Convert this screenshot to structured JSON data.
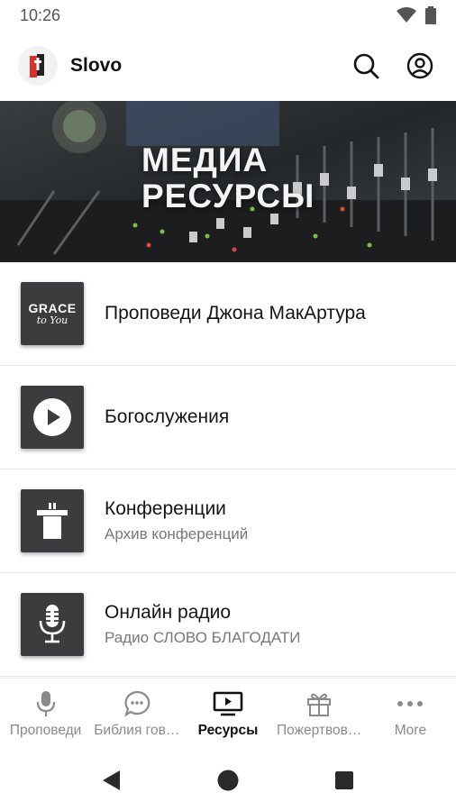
{
  "status_bar": {
    "time": "10:26"
  },
  "app_bar": {
    "title": "Slovo"
  },
  "banner": {
    "title_line1": "МЕДИА",
    "title_line2": "РЕСУРСЫ"
  },
  "list": [
    {
      "title": "Проповеди Джона МакАртура",
      "subtitle": "",
      "logo_text_1": "GRACE",
      "logo_text_2": "to You"
    },
    {
      "title": "Богослужения",
      "subtitle": ""
    },
    {
      "title": "Конференции",
      "subtitle": "Архив конференций"
    },
    {
      "title": "Онлайн радио",
      "subtitle": "Радио СЛОВО БЛАГОДАТИ"
    }
  ],
  "bottom_nav": [
    {
      "label": "Проповеди",
      "icon": "microphone-icon",
      "active": false
    },
    {
      "label": "Библия гов…",
      "icon": "chat-bubble-icon",
      "active": false
    },
    {
      "label": "Ресурсы",
      "icon": "tv-play-icon",
      "active": true
    },
    {
      "label": "Пожертвов…",
      "icon": "gift-icon",
      "active": false
    },
    {
      "label": "More",
      "icon": "more-dots-icon",
      "active": false
    }
  ],
  "colors": {
    "accent_red": "#d9302c",
    "thumb_bg": "#3b3c3e",
    "active_nav": "#111111",
    "inactive_nav": "#8a8a8a"
  }
}
